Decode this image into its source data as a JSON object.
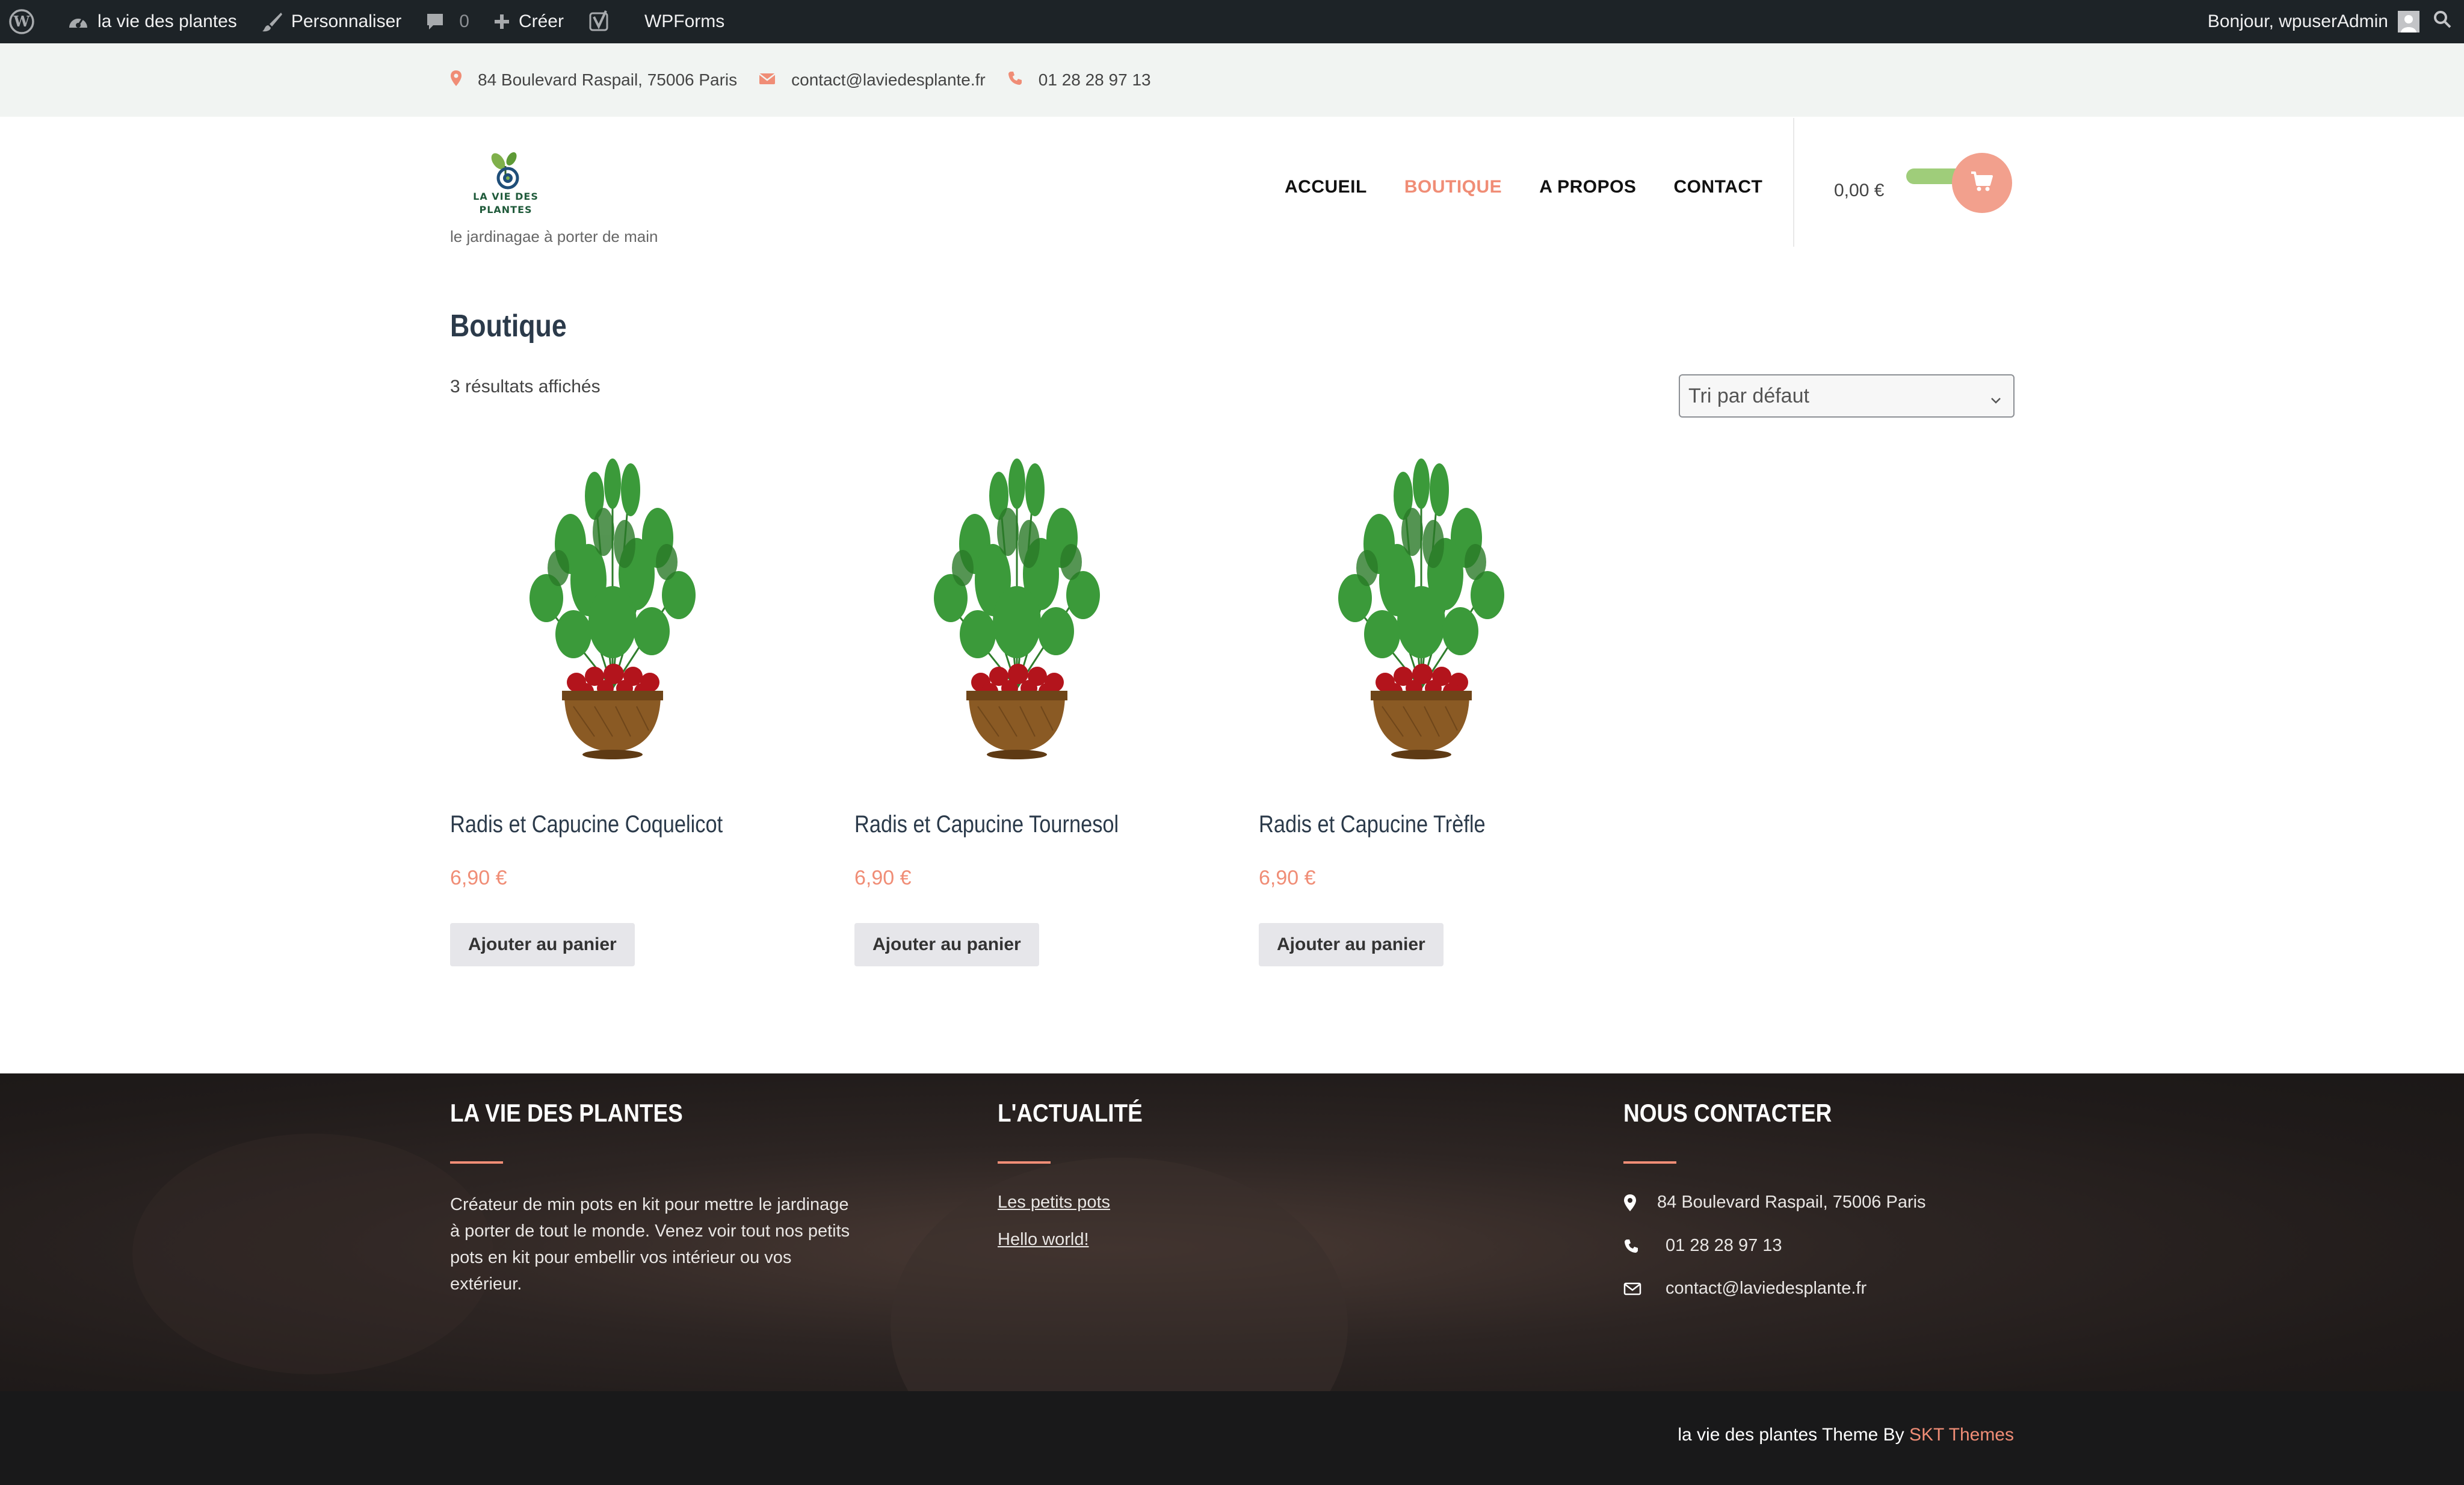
{
  "admin_bar": {
    "site_name": "la vie des plantes",
    "customize": "Personnaliser",
    "comments_count": "0",
    "new": "Créer",
    "wpforms": "WPForms",
    "greeting": "Bonjour, wpuserAdmin"
  },
  "topbar": {
    "address": "84 Boulevard Raspail, 75006 Paris",
    "email": "contact@laviedesplante.fr",
    "phone": "01 28 28 97 13"
  },
  "header": {
    "logo_line1": "LA VIE DES",
    "logo_line2": "PLANTES",
    "tagline": "le jardinagae à porter de main",
    "nav": [
      "ACCUEIL",
      "BOUTIQUE",
      "A PROPOS",
      "CONTACT"
    ],
    "active_nav": "BOUTIQUE",
    "cart_total": "0,00 €"
  },
  "main": {
    "title": "Boutique",
    "result_count": "3 résultats affichés",
    "sort_selected": "Tri par défaut",
    "products": [
      {
        "name": "Radis et Capucine Coquelicot",
        "price": "6,90 €",
        "button": "Ajouter au panier"
      },
      {
        "name": "Radis et Capucine Tournesol",
        "price": "6,90 €",
        "button": "Ajouter au panier"
      },
      {
        "name": "Radis et Capucine Trèfle",
        "price": "6,90 €",
        "button": "Ajouter au panier"
      }
    ]
  },
  "footer": {
    "col1_title": "LA VIE DES PLANTES",
    "col1_text": "Créateur de min pots en kit pour mettre le jardinage à porter de tout le monde. Venez voir tout nos petits pots en kit pour embellir vos intérieur ou vos extérieur.",
    "col2_title": "L'ACTUALITÉ",
    "col2_links": [
      "Les petits pots",
      "Hello world!"
    ],
    "col3_title": "NOUS CONTACTER",
    "address": "84 Boulevard Raspail, 75006 Paris",
    "phone": "01 28 28 97 13",
    "email": "contact@laviedesplante.fr",
    "credits_text": "la vie des plantes Theme By",
    "credits_link": "SKT Themes"
  },
  "colors": {
    "accent": "#f08d76",
    "admin_bar": "#1d2327",
    "topbar_bg": "#f1f4f2",
    "cart_pill": "#9fcd7a",
    "footer_bg": "#2d2523",
    "bottom_bar": "#19191a"
  },
  "icons": {
    "admin": [
      "wordpress-icon",
      "dashboard-icon",
      "brush-icon",
      "comment-icon",
      "plus-icon",
      "yoast-icon",
      "avatar-icon",
      "search-icon"
    ],
    "topbar": [
      "map-pin-icon",
      "envelope-icon",
      "phone-icon"
    ],
    "header": [
      "cart-icon"
    ],
    "footer": [
      "map-pin-icon",
      "phone-icon",
      "envelope-icon"
    ]
  }
}
